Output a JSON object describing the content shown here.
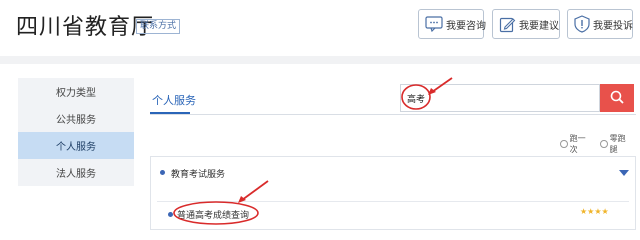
{
  "header": {
    "title": "四川省教育厅",
    "contact_label": "联系方式",
    "buttons": {
      "consult": "我要咨询",
      "suggest": "我要建议",
      "complain": "我要投诉"
    }
  },
  "sidebar": {
    "items": [
      {
        "label": "权力类型",
        "active": false
      },
      {
        "label": "公共服务",
        "active": false
      },
      {
        "label": "个人服务",
        "active": true
      },
      {
        "label": "法人服务",
        "active": false
      }
    ]
  },
  "main": {
    "tab_label": "个人服务",
    "search": {
      "value": "高考",
      "icon": "search-icon"
    },
    "filters": {
      "option1": "跑一次",
      "option2": "零跑腿"
    },
    "panel": {
      "title": "教育考试服务",
      "item": "普通高考成绩查询",
      "rating_stars": "★★★★"
    }
  },
  "colors": {
    "accent": "#2a65b8",
    "search_button": "#e8514b",
    "annotation": "#d92b2b"
  }
}
